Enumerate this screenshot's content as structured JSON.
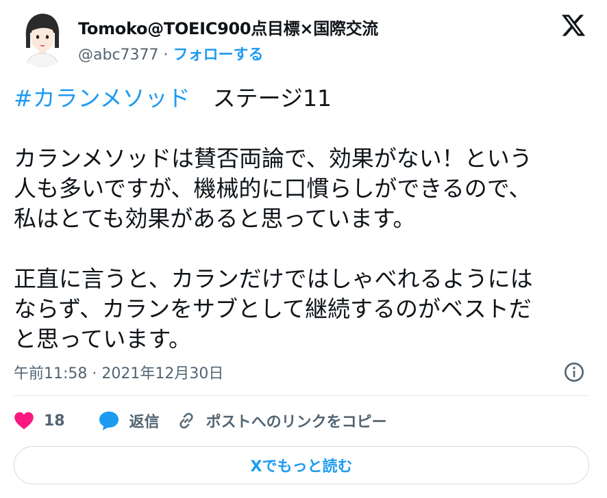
{
  "author": {
    "display_name": "Tomoko@TOEIC900点目標×国際交流",
    "handle": "@abc7377",
    "separator": "·",
    "follow_label": "フォローする"
  },
  "tweet": {
    "hashtag": "#カランメソッド",
    "line1_rest": "　ステージ11",
    "para1": [
      "カランメソッドは賛否両論で、効果がない！という",
      "人も多いですが、機械的に口慣らしができるので、",
      "私はとても効果があると思っています。"
    ],
    "para2": [
      "正直に言うと、カランだけではしゃべれるようには",
      "ならず、カランをサブとして継続するのがベストだ",
      "と思っています。"
    ],
    "time": "午前11:58",
    "date": "2021年12月30日",
    "meta_separator": "·"
  },
  "actions": {
    "likes": "18",
    "reply_label": "返信",
    "copy_link_label": "ポストへのリンクをコピー"
  },
  "footer": {
    "read_more_label": "Xでもっと読む"
  },
  "colors": {
    "accent": "#1d9bf0",
    "like": "#f91880",
    "muted": "#536471",
    "text": "#0f1419"
  },
  "icons": {
    "logo": "x-logo-icon",
    "info": "info-icon",
    "like": "heart-icon",
    "reply": "speech-bubble-icon",
    "copy": "link-icon"
  }
}
